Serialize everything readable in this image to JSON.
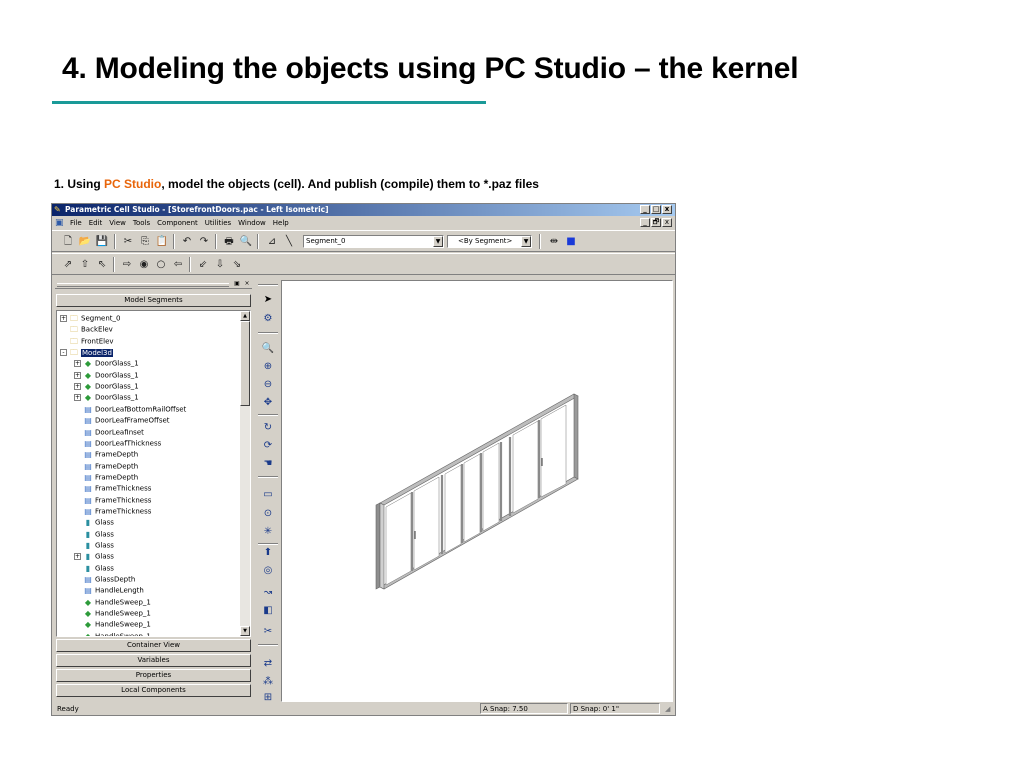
{
  "slide": {
    "title": "4. Modeling the objects using PC Studio – the kernel",
    "subtitle_prefix": "1. Using ",
    "subtitle_highlight": "PC Studio",
    "subtitle_suffix": ", model the objects (cell). And publish (compile) them to *.paz files",
    "accent_color": "#e8650a",
    "rule_color": "#1a9a98"
  },
  "window": {
    "title": "Parametric Cell Studio - [StorefrontDoors.pac - Left Isometric]",
    "buttons": [
      "_",
      "□",
      "x"
    ],
    "mdi_buttons": [
      "_",
      "🗗",
      "x"
    ]
  },
  "menu": [
    "File",
    "Edit",
    "View",
    "Tools",
    "Component",
    "Utilities",
    "Window",
    "Help"
  ],
  "toolbar": {
    "segment_combo": "Segment_0",
    "by_segment_combo": "<By Segment>"
  },
  "panel": {
    "header": "Model Segments",
    "sections": [
      "Container View",
      "Variables",
      "Properties",
      "Local Components"
    ]
  },
  "tree": [
    {
      "label": "Segment_0",
      "indent": 0,
      "exp": "+",
      "icon": "segment-icon"
    },
    {
      "label": "BackElev",
      "indent": 0,
      "exp": "",
      "icon": "segment-icon"
    },
    {
      "label": "FrontElev",
      "indent": 0,
      "exp": "",
      "icon": "segment-icon"
    },
    {
      "label": "Model3d",
      "indent": 0,
      "exp": "-",
      "icon": "segment-icon",
      "selected": true
    },
    {
      "label": "DoorGlass_1",
      "indent": 1,
      "exp": "+",
      "icon": "component-icon"
    },
    {
      "label": "DoorGlass_1",
      "indent": 1,
      "exp": "+",
      "icon": "component-icon"
    },
    {
      "label": "DoorGlass_1",
      "indent": 1,
      "exp": "+",
      "icon": "component-icon"
    },
    {
      "label": "DoorGlass_1",
      "indent": 1,
      "exp": "+",
      "icon": "component-icon"
    },
    {
      "label": "DoorLeafBottomRailOffset",
      "indent": 1,
      "exp": "",
      "icon": "variable-icon"
    },
    {
      "label": "DoorLeafFrameOffset",
      "indent": 1,
      "exp": "",
      "icon": "variable-icon"
    },
    {
      "label": "DoorLeafInset",
      "indent": 1,
      "exp": "",
      "icon": "variable-icon"
    },
    {
      "label": "DoorLeafThickness",
      "indent": 1,
      "exp": "",
      "icon": "variable-icon"
    },
    {
      "label": "FrameDepth",
      "indent": 1,
      "exp": "",
      "icon": "variable-icon"
    },
    {
      "label": "FrameDepth",
      "indent": 1,
      "exp": "",
      "icon": "variable-icon"
    },
    {
      "label": "FrameDepth",
      "indent": 1,
      "exp": "",
      "icon": "variable-icon"
    },
    {
      "label": "FrameThickness",
      "indent": 1,
      "exp": "",
      "icon": "variable-icon"
    },
    {
      "label": "FrameThickness",
      "indent": 1,
      "exp": "",
      "icon": "variable-icon"
    },
    {
      "label": "FrameThickness",
      "indent": 1,
      "exp": "",
      "icon": "variable-icon"
    },
    {
      "label": "Glass",
      "indent": 1,
      "exp": "",
      "icon": "glass-icon"
    },
    {
      "label": "Glass",
      "indent": 1,
      "exp": "",
      "icon": "glass-icon"
    },
    {
      "label": "Glass",
      "indent": 1,
      "exp": "",
      "icon": "glass-icon"
    },
    {
      "label": "Glass",
      "indent": 1,
      "exp": "+",
      "icon": "glass-icon"
    },
    {
      "label": "Glass",
      "indent": 1,
      "exp": "",
      "icon": "glass-icon"
    },
    {
      "label": "GlassDepth",
      "indent": 1,
      "exp": "",
      "icon": "variable-icon"
    },
    {
      "label": "HandleLength",
      "indent": 1,
      "exp": "",
      "icon": "variable-icon"
    },
    {
      "label": "HandleSweep_1",
      "indent": 1,
      "exp": "",
      "icon": "component-icon"
    },
    {
      "label": "HandleSweep_1",
      "indent": 1,
      "exp": "",
      "icon": "component-icon"
    },
    {
      "label": "HandleSweep_1",
      "indent": 1,
      "exp": "",
      "icon": "component-icon"
    },
    {
      "label": "HandleSweep_1",
      "indent": 1,
      "exp": "",
      "icon": "component-icon"
    }
  ],
  "status": {
    "ready": "Ready",
    "a_snap": "A Snap: 7.50",
    "d_snap": "D Snap: 0' 1\""
  }
}
